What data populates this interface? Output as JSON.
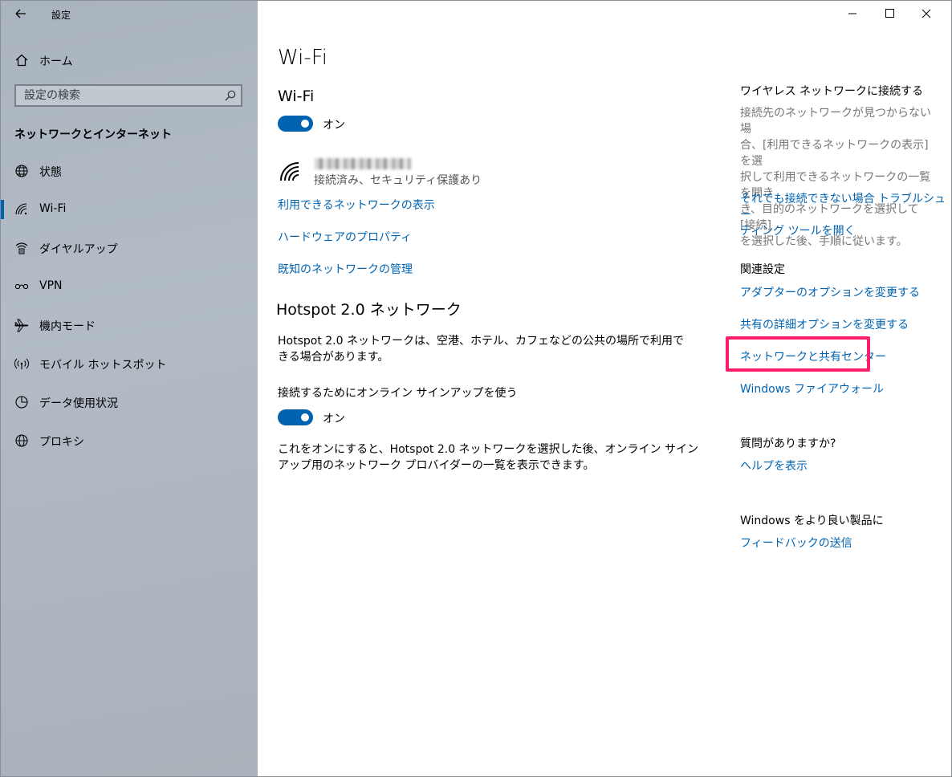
{
  "window": {
    "title": "設定",
    "controls": [
      "minimize-icon",
      "maximize-icon",
      "close-icon"
    ]
  },
  "sidebar": {
    "home_label": "ホーム",
    "search_placeholder": "設定の検索",
    "section_title": "ネットワークとインターネット",
    "items": [
      {
        "label": "状態",
        "icon": "status-globe-icon"
      },
      {
        "label": "Wi-Fi",
        "icon": "wifi-icon",
        "selected": true
      },
      {
        "label": "ダイヤルアップ",
        "icon": "dialup-icon"
      },
      {
        "label": "VPN",
        "icon": "vpn-icon"
      },
      {
        "label": "機内モード",
        "icon": "airplane-icon"
      },
      {
        "label": "モバイル ホットスポット",
        "icon": "hotspot-icon"
      },
      {
        "label": "データ使用状況",
        "icon": "data-usage-icon"
      },
      {
        "label": "プロキシ",
        "icon": "proxy-globe-icon"
      }
    ],
    "accent": "#0063b1"
  },
  "main": {
    "page_title": "Wi-Fi",
    "wifi_section_title": "Wi-Fi",
    "wifi_toggle_label": "オン",
    "network_status": "接続済み、セキュリティ保護あり",
    "links": [
      "利用できるネットワークの表示",
      "ハードウェアのプロパティ",
      "既知のネットワークの管理"
    ],
    "hotspot_title": "Hotspot 2.0 ネットワーク",
    "hotspot_desc_line1": "Hotspot 2.0 ネットワークは、空港、ホテル、カフェなどの公共の場所で利用で",
    "hotspot_desc_line2": "きる場合があります。",
    "signup_label": "接続するためにオンライン サインアップを使う",
    "signup_toggle_label": "オン",
    "signup_desc_line1": "これをオンにすると、Hotspot 2.0 ネットワークを選択した後、オンライン サイン",
    "signup_desc_line2": "アップ用のネットワーク プロバイダーの一覧を表示できます。"
  },
  "right": {
    "connect_title": "ワイヤレス ネットワークに接続する",
    "connect_desc": [
      "接続先のネットワークが見つからない場",
      "合、[利用できるネットワークの表示] を選",
      "択して利用できるネットワークの一覧を開き",
      "き、目的のネットワークを選択して [接続]",
      "を選択した後、手順に従います。"
    ],
    "troubleshoot_line1": "それでも接続できない場合 トラブルシュー",
    "troubleshoot_line2": "ティング ツールを開く",
    "related_title": "関連設定",
    "related_links": [
      "アダプターのオプションを変更する",
      "共有の詳細オプションを変更する",
      "ネットワークと共有センター",
      "Windows ファイアウォール"
    ],
    "question_title": "質問がありますか?",
    "help_link": "ヘルプを表示",
    "better_title": "Windows をより良い製品に",
    "feedback_link": "フィードバックの送信",
    "highlight_color": "#ff1e6e"
  }
}
